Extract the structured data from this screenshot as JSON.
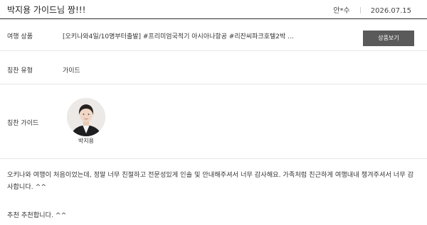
{
  "review": {
    "title": "박지용 가이드님 짱!!!",
    "author": "안*수",
    "date": "2026.07.15"
  },
  "details": {
    "product_label": "여행 상품",
    "product_value": "[오키나와4일/10명부터출발] #프리미엄국적기 아시아나항공 #리잔씨파크호텔2박 ...",
    "product_button": "상품보기",
    "type_label": "칭찬 유형",
    "type_value": "가이드",
    "guide_label": "칭찬 가이드",
    "guide_name": "박지용"
  },
  "body": {
    "text": "오키나와 여행이 처음이었는데, 정말 너무 친절하고 전문성있게 인솔 및 안내해주셔서 너무 감사해요. 가족처럼 친근하게 여행내내 챙겨주셔서 너무 감사합니다. ^^",
    "recommend": "추천 추천합니다. ^^"
  }
}
